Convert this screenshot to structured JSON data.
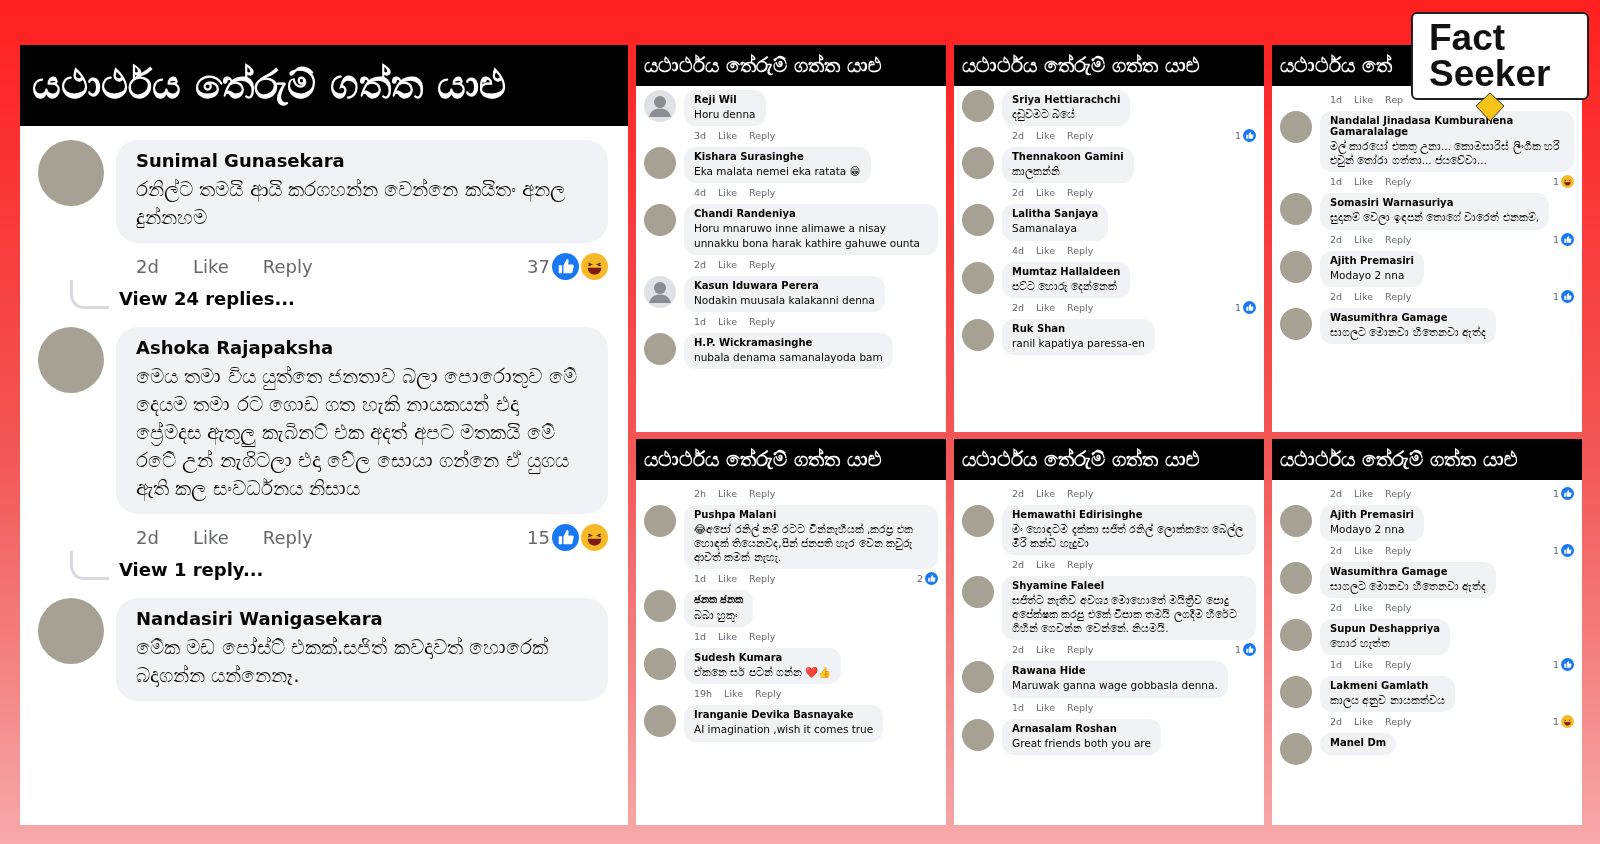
{
  "panels": [
    {
      "kind": "large",
      "title": "යථාර්ථය තේරුම් ගත්ත යාළු",
      "items": [
        {
          "kind": "comment",
          "default_avatar": false,
          "name": "Sunimal Gunasekara",
          "text": "රනිල්ට තමයි ආයි කරගහන්න වෙන්නෙ කයිතං අනල දුන්නහම",
          "time": "2d",
          "like": "Like",
          "reply": "Reply",
          "reaction_count": "37",
          "like_reaction": true,
          "haha_reaction": true,
          "view_replies": "View 24 replies..."
        },
        {
          "kind": "comment",
          "default_avatar": false,
          "name": "Ashoka Rajapaksha",
          "text": "මෙය තමා විය යුත්තෙ ජනතාව  බලා පොරොතුව මේ දෙයම තමා රට ගොඩ ගත හැකි නායකයන්  එදා ප්‍රේමදස  ඇතුලු කැබිනට් එක අදත් අපට මතකයි මේ රටේ උන් නැගිටලා එදා වේල සොයා ගන්නෙ ඒ යුගය ඇති කල සංවර්ධනය  නිසාය",
          "time": "2d",
          "like": "Like",
          "reply": "Reply",
          "reaction_count": "15",
          "like_reaction": true,
          "haha_reaction": true,
          "view_replies": "View 1 reply..."
        },
        {
          "kind": "comment",
          "default_avatar": false,
          "name": "Nandasiri Wanigasekara",
          "text": "මේක මඩ පෝස්ට් එකක්.සජිත් කවදාවත් හොරෙක් බදාගන්න යන්නෙනෑ."
        }
      ]
    },
    {
      "kind": "small",
      "title": "යථාර්ථය තේරුම් ගත්ත යාළු",
      "items": [
        {
          "kind": "comment",
          "default_avatar": true,
          "name": "Reji Wil",
          "text": "Horu denna",
          "time": "3d",
          "like": "Like",
          "reply": "Reply"
        },
        {
          "kind": "comment",
          "default_avatar": false,
          "name": "Kishara Surasinghe",
          "text": "Eka malata nemei eka ratata 😁",
          "time": "4d",
          "like": "Like",
          "reply": "Reply"
        },
        {
          "kind": "comment",
          "default_avatar": false,
          "name": "Chandi Randeniya",
          "text": "Horu  mnaruwo  inne  alimawe  a nisay unnakku  bona  harak  kathire  gahuwe ounta",
          "time": "2d",
          "like": "Like",
          "reply": "Reply"
        },
        {
          "kind": "comment",
          "default_avatar": true,
          "name": "Kasun Iduwara Perera",
          "text": "Nodakin muusala kalakanni denna",
          "time": "1d",
          "like": "Like",
          "reply": "Reply"
        },
        {
          "kind": "comment",
          "default_avatar": false,
          "name": "H.P. Wickramasinghe",
          "text": "nubala denama samanalayoda bam"
        }
      ]
    },
    {
      "kind": "small",
      "title": "යථාර්ථය තේරුම් ගත්ත යාළු",
      "items": [
        {
          "kind": "comment",
          "default_avatar": false,
          "name": "Sriya Hettiarachchi",
          "text": "දඩුවමට බයේ",
          "time": "2d",
          "like": "Like",
          "reply": "Reply",
          "reaction_count": "1",
          "like_reaction": true,
          "haha_reaction": false
        },
        {
          "kind": "comment",
          "default_avatar": false,
          "name": "Thennakoon Gamini",
          "text": "කාලකන්නි",
          "time": "2d",
          "like": "Like",
          "reply": "Reply"
        },
        {
          "kind": "comment",
          "default_avatar": false,
          "name": "Lalitha Sanjaya",
          "text": "Samanalaya",
          "time": "4d",
          "like": "Like",
          "reply": "Reply"
        },
        {
          "kind": "comment",
          "default_avatar": false,
          "name": "Mumtaz Hallaldeen",
          "text": "පට්ට හොරු දෙන්නෙක්",
          "time": "2d",
          "like": "Like",
          "reply": "Reply",
          "reaction_count": "1",
          "like_reaction": true,
          "haha_reaction": false
        },
        {
          "kind": "comment",
          "default_avatar": false,
          "name": "Ruk Shan",
          "text": "ranil kapatiya paressa-en"
        }
      ]
    },
    {
      "kind": "small",
      "title": "යථාර්ථය තේ",
      "items": [
        {
          "kind": "meta",
          "time": "1d",
          "like": "Like",
          "reply": "Rep"
        },
        {
          "kind": "comment",
          "default_avatar": false,
          "name": "Nandalal Jinadasa Kumburahena Gamaralalage",
          "text": "මල් කාරයෝ එකතු උනා... කොමසාරිස් ලිංගික හරි එවුන් තෝරා ගත්තා... ජයවේවා...",
          "time": "1d",
          "like": "Like",
          "reply": "Reply",
          "reaction_count": "1",
          "like_reaction": false,
          "haha_reaction": true
        },
        {
          "kind": "comment",
          "default_avatar": false,
          "name": "Somasiri Warnasuriya",
          "text": "සුදානම් වෙලා ඉඳපන් තොගේ වාරෙත් එනකම්,",
          "time": "2d",
          "like": "Like",
          "reply": "Reply",
          "reaction_count": "1",
          "like_reaction": true,
          "haha_reaction": false
        },
        {
          "kind": "comment",
          "default_avatar": false,
          "name": "Ajith Premasiri",
          "text": "Modayo  2 nna",
          "time": "2d",
          "like": "Like",
          "reply": "Reply",
          "reaction_count": "1",
          "like_reaction": true,
          "haha_reaction": false
        },
        {
          "kind": "comment",
          "default_avatar": false,
          "name": "Wasumithra Gamage",
          "text": "සාගලට මොනවා හිතෙනවා ඇත්ද"
        }
      ]
    },
    {
      "kind": "small",
      "title": "යථාර්ථය තේරුම් ගත්ත යාළු",
      "items": [
        {
          "kind": "meta",
          "time": "2h",
          "like": "Like",
          "reply": "Reply"
        },
        {
          "kind": "comment",
          "default_avatar": false,
          "name": "Pushpa Malani",
          "text": "😂අපෝ රනිල් නම් රටට වින්නැහියක් ,කරප්‍ර එක හොඳක් තියෙනවද,පින් ජනපති හැර වෙන කවුරු ආවත් කමක් නැහැ.",
          "time": "1d",
          "like": "Like",
          "reply": "Reply",
          "reaction_count": "2",
          "like_reaction": true,
          "haha_reaction": false
        },
        {
          "kind": "comment",
          "default_avatar": false,
          "name": "ජනක ජනක",
          "text": "බබා හුකුං",
          "time": "1d",
          "like": "Like",
          "reply": "Reply"
        },
        {
          "kind": "comment",
          "default_avatar": false,
          "name": "Sudesh Kumara",
          "text": "ඒකනෙ සර් පටන් ගන්න ❤️👍",
          "time": "19h",
          "like": "Like",
          "reply": "Reply"
        },
        {
          "kind": "comment",
          "default_avatar": false,
          "name": "Iranganie Devika Basnayake",
          "text": "AI imagination ,wish it comes true"
        }
      ]
    },
    {
      "kind": "small",
      "title": "යථාර්ථය තේරුම් ගත්ත යාළු",
      "items": [
        {
          "kind": "meta",
          "time": "2d",
          "like": "Like",
          "reply": "Reply"
        },
        {
          "kind": "comment",
          "default_avatar": false,
          "name": "Hemawathi Edirisinghe",
          "text": "මං හොඳටම දැක්කා සජිත් රනිල් ලොක්කගෙ බෙල්ල මිරි කන්ඩ හැදුවා",
          "time": "2d",
          "like": "Like",
          "reply": "Reply"
        },
        {
          "kind": "comment",
          "default_avatar": false,
          "name": "Shyamine Faleel",
          "text": "සජිත්ට නැතිව අවශ්‍ය මොහොතේ මයිත්‍රීව පොදු අපේක්ෂක කරපු එකේ විපාක තමයි ලගදීම හිරේට ගිහින් ගෙවන්න වෙන්නේ. නියමයි.",
          "time": "2d",
          "like": "Like",
          "reply": "Reply",
          "reaction_count": "1",
          "like_reaction": true,
          "haha_reaction": false
        },
        {
          "kind": "comment",
          "default_avatar": false,
          "name": "Rawana Hide",
          "text": "Maruwak ganna wage gobbasla denna.",
          "time": "1d",
          "like": "Like",
          "reply": "Reply"
        },
        {
          "kind": "comment",
          "default_avatar": false,
          "name": "Arnasalam Roshan",
          "text": "Great friends both you are"
        }
      ]
    },
    {
      "kind": "small",
      "title": "යථාර්ථය තේරුම් ගත්ත යාළු",
      "items": [
        {
          "kind": "meta",
          "time": "2d",
          "like": "Like",
          "reply": "Reply",
          "reaction_count": "1",
          "like_reaction": true,
          "haha_reaction": false
        },
        {
          "kind": "comment",
          "default_avatar": false,
          "name": "Ajith Premasiri",
          "text": "Modayo  2 nna",
          "time": "2d",
          "like": "Like",
          "reply": "Reply",
          "reaction_count": "1",
          "like_reaction": true,
          "haha_reaction": false
        },
        {
          "kind": "comment",
          "default_avatar": false,
          "name": "Wasumithra Gamage",
          "text": "සාගලට මොනවා හිතෙනවා ඇත්ද",
          "time": "2d",
          "like": "Like",
          "reply": "Reply"
        },
        {
          "kind": "comment",
          "default_avatar": false,
          "name": "Supun Deshappriya",
          "text": "හොර හැත්ත",
          "time": "1d",
          "like": "Like",
          "reply": "Reply",
          "reaction_count": "1",
          "like_reaction": true,
          "haha_reaction": false
        },
        {
          "kind": "comment",
          "default_avatar": false,
          "name": "Lakmeni Gamlath",
          "text": "කාලය අනුව නායකත්වය",
          "time": "2d",
          "like": "Like",
          "reply": "Reply",
          "reaction_count": "1",
          "like_reaction": false,
          "haha_reaction": true
        },
        {
          "kind": "comment",
          "default_avatar": false,
          "name": "Manel Dm"
        }
      ]
    }
  ],
  "logo": {
    "line_1": "Fact",
    "line_2": "Seeker"
  }
}
